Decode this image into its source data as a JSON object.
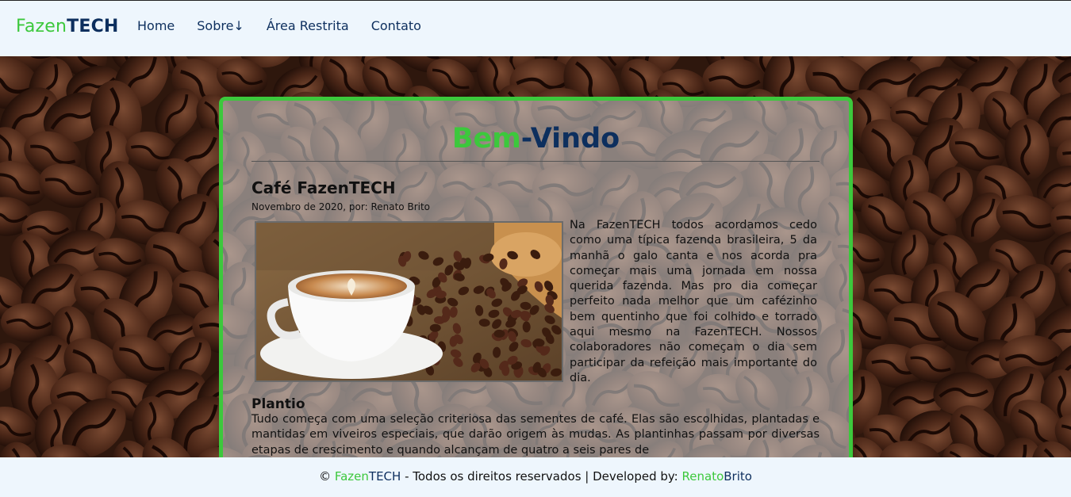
{
  "brand": {
    "part1": "Fazen",
    "part2": "TECH"
  },
  "nav": {
    "items": [
      {
        "label": "Home"
      },
      {
        "label": "Sobre↓"
      },
      {
        "label": "Área Restrita"
      },
      {
        "label": "Contato"
      }
    ]
  },
  "card": {
    "welcome_part1": "Bem",
    "welcome_sep": "-",
    "welcome_part2": "Vindo",
    "post_title": "Café FazenTECH",
    "post_meta": "Novembro de 2020, por: Renato Brito",
    "photo_alt": "Xícara de café com grãos",
    "intro": "Na FazenTECH todos acordamos cedo como uma típica fazenda brasileira, 5 da manhã o galo canta e nos acorda pra começar mais uma jornada em nossa querida fazenda. Mas pro dia começar perfeito nada melhor que um cafézinho bem quentinho que foi colhido e torrado aqui mesmo na FazenTECH. Nossos colaboradores não começam o dia sem participar da refeição mais importante do dia.",
    "section_title": "Plantio",
    "section_text": "Tudo começa com uma seleção criteriosa das sementes de café. Elas são escolhidas, plantadas e mantidas em viveiros especiais, que darão origem às mudas. As plantinhas passam por diversas etapas de crescimento e quando alcançam de quatro a seis pares de"
  },
  "footer": {
    "copy": "© ",
    "brand1": "Fazen",
    "brand2": "TECH",
    "middle": " - Todos os direitos reservados | Developed by: ",
    "dev1": "Renato",
    "dev2": "Brito"
  },
  "colors": {
    "green": "#3cc83c",
    "navy": "#0d2f5e",
    "header_bg": "#eef6fd"
  }
}
